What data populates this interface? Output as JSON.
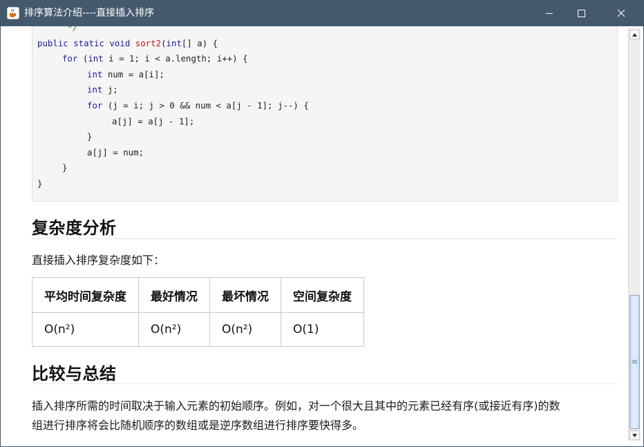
{
  "window": {
    "title": "排序算法介绍----直接插入排序",
    "icon": "java-cup-icon",
    "controls": [
      "minimize-icon",
      "maximize-icon",
      "close-icon"
    ]
  },
  "code": {
    "lines": [
      {
        "indent": 1,
        "parts": [
          {
            "t": " */",
            "c": "cm"
          }
        ]
      },
      {
        "indent": 0,
        "parts": [
          {
            "t": "public static void ",
            "c": "kw"
          },
          {
            "t": "sort2",
            "c": "fn"
          },
          {
            "t": "(",
            "c": ""
          },
          {
            "t": "int",
            "c": "kw"
          },
          {
            "t": "[] a) {",
            "c": ""
          }
        ]
      },
      {
        "indent": 1,
        "parts": [
          {
            "t": "for",
            "c": "kw"
          },
          {
            "t": " (",
            "c": ""
          },
          {
            "t": "int",
            "c": "kw"
          },
          {
            "t": " i = 1; i < a.length; i++) {",
            "c": ""
          }
        ]
      },
      {
        "indent": 2,
        "parts": [
          {
            "t": "int",
            "c": "kw"
          },
          {
            "t": " num = a[i];",
            "c": ""
          }
        ]
      },
      {
        "indent": 2,
        "parts": [
          {
            "t": "int",
            "c": "kw"
          },
          {
            "t": " j;",
            "c": ""
          }
        ]
      },
      {
        "indent": 2,
        "parts": [
          {
            "t": "for",
            "c": "kw"
          },
          {
            "t": " (j = i; j > 0 && num < a[j - 1]; j--) {",
            "c": ""
          }
        ]
      },
      {
        "indent": 3,
        "parts": [
          {
            "t": "a[j] = a[j - 1];",
            "c": ""
          }
        ]
      },
      {
        "indent": 2,
        "parts": [
          {
            "t": "}",
            "c": ""
          }
        ]
      },
      {
        "indent": 2,
        "parts": [
          {
            "t": "a[j] = num;",
            "c": ""
          }
        ]
      },
      {
        "indent": 1,
        "parts": [
          {
            "t": "}",
            "c": ""
          }
        ]
      },
      {
        "indent": 0,
        "parts": [
          {
            "t": "}",
            "c": ""
          }
        ]
      }
    ]
  },
  "complexity": {
    "heading": "复杂度分析",
    "intro": "直接插入排序复杂度如下：",
    "table": {
      "headers": [
        "平均时间复杂度",
        "最好情况",
        "最坏情况",
        "空间复杂度"
      ],
      "rows": [
        [
          "O(n²)",
          "O(n²)",
          "O(n²)",
          "O(1)"
        ]
      ]
    }
  },
  "summary": {
    "heading": "比较与总结",
    "lines": [
      "插入排序所需的时间取决于输入元素的初始顺序。例如，对一个很大且其中的元素已经有序(或接近有序)的数",
      "组进行排序将会比随机顺序的数组或是逆序数组进行排序要快得多。"
    ]
  },
  "scrollbar": {
    "position_fraction": 0.64
  }
}
